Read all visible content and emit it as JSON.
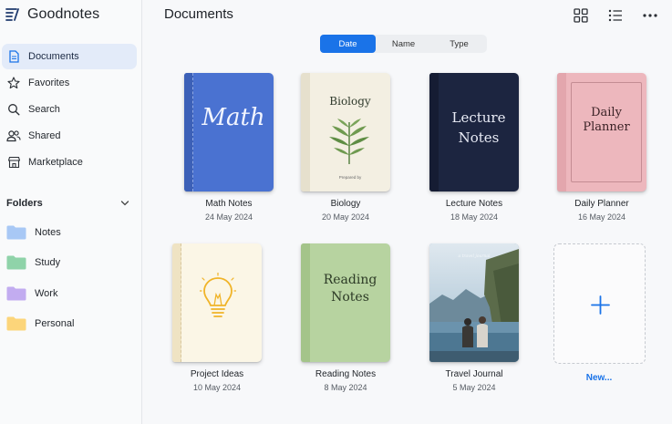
{
  "app": {
    "name": "Goodnotes"
  },
  "sidebar": {
    "items": [
      {
        "label": "Documents",
        "icon": "document-icon",
        "active": true
      },
      {
        "label": "Favorites",
        "icon": "star-icon",
        "active": false
      },
      {
        "label": "Search",
        "icon": "search-icon",
        "active": false
      },
      {
        "label": "Shared",
        "icon": "people-icon",
        "active": false
      },
      {
        "label": "Marketplace",
        "icon": "store-icon",
        "active": false
      }
    ],
    "folders_title": "Folders",
    "folders": [
      {
        "label": "Notes",
        "color": "#a8c8f5"
      },
      {
        "label": "Study",
        "color": "#8fd3a9"
      },
      {
        "label": "Work",
        "color": "#c2acf0"
      },
      {
        "label": "Personal",
        "color": "#fcd57a"
      }
    ]
  },
  "main": {
    "title": "Documents",
    "sort": {
      "options": [
        "Date",
        "Name",
        "Type"
      ],
      "selected": "Date"
    },
    "documents": [
      {
        "name": "Math Notes",
        "date": "24 May 2024",
        "cover_text": "Math",
        "cover_color": "#4a72d1"
      },
      {
        "name": "Biology",
        "date": "20 May 2024",
        "cover_text": "Biology",
        "cover_subtext": "Prepared by",
        "cover_color": "#f3efe2"
      },
      {
        "name": "Lecture Notes",
        "date": "18 May 2024",
        "cover_text_line1": "Lecture",
        "cover_text_line2": "Notes",
        "cover_color": "#1c2540"
      },
      {
        "name": "Daily Planner",
        "date": "16 May 2024",
        "cover_text_line1": "Daily",
        "cover_text_line2": "Planner",
        "cover_color": "#edb7bd"
      },
      {
        "name": "Project Ideas",
        "date": "10 May 2024",
        "cover_color": "#fbf6e6"
      },
      {
        "name": "Reading Notes",
        "date": "8 May 2024",
        "cover_text_line1": "Reading",
        "cover_text_line2": "Notes",
        "cover_color": "#b7d3a0"
      },
      {
        "name": "Travel Journal",
        "date": "5 May 2024",
        "cover_caption": "a travel journal",
        "cover_color": "#7fa3bd"
      }
    ],
    "new_label": "New..."
  },
  "colors": {
    "accent": "#1a73e8"
  }
}
